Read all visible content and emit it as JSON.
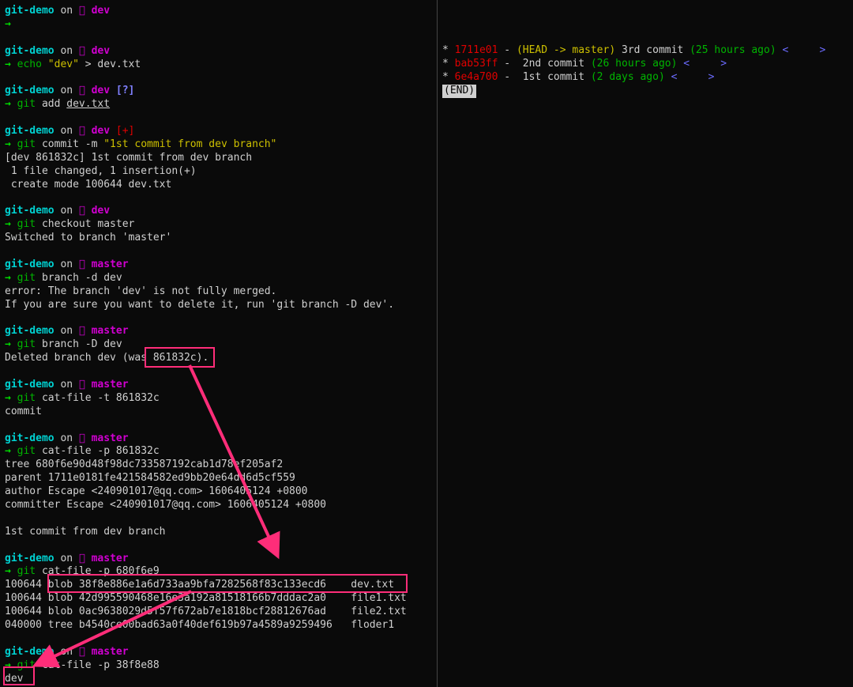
{
  "prompt": {
    "dir": "git-demo",
    "on": "on",
    "branch_dev": "dev",
    "branch_master": "master",
    "flag_untracked": "[?]",
    "flag_staged": "[+]",
    "arrow": "→"
  },
  "cmds": {
    "echo": "echo",
    "echo_arg": "\"dev\"",
    "echo_redir": " > dev.txt",
    "git": "git",
    "add": " add ",
    "add_file": "dev.txt",
    "commit": " commit -m ",
    "commit_msg": "\"1st commit from dev branch\"",
    "checkout": " checkout master",
    "branch_d": " branch -d dev",
    "branch_D": " branch -D dev",
    "catfile_t": " cat-file -t 861832c",
    "catfile_p1": " cat-file -p 861832c",
    "catfile_p2": " cat-file -p 680f6e9",
    "catfile_p3": " cat-file -p 38f8e88"
  },
  "out": {
    "commit1": "[dev 861832c] 1st commit from dev branch",
    "commit2": " 1 file changed, 1 insertion(+)",
    "commit3": " create mode 100644 dev.txt",
    "switched": "Switched to branch 'master'",
    "err1": "error: The branch 'dev' is not fully merged.",
    "err2": "If you are sure you want to delete it, run 'git branch -D dev'.",
    "deleted_a": "Deleted branch dev (was",
    "deleted_b": " 861832c).",
    "type": "commit",
    "tree": "tree 680f6e90d48f98dc733587192cab1d78ef205af2",
    "parent": "parent 1711e0181fe421584582ed9bb20e64dd6d5cf559",
    "author": "author Escape <240901017@qq.com> 1606405124 +0800",
    "committer": "committer Escape <240901017@qq.com> 1606405124 +0800",
    "msg": "1st commit from dev branch",
    "ls1a": "100644 ",
    "ls1b": "blob 38f8e886e1a6d733aa9bfa7282568f83c133ecd6    dev.txt",
    "ls2": "100644 blob 42d995590468e16e3a192a81518166b7dddac2a0    file1.txt",
    "ls3": "100644 blob 0ac9638029d5f57f672ab7e1818bcf28812676ad    file2.txt",
    "ls4": "040000 tree b4540ce00bad63a0f40def619b97a4589a9259496   floder1",
    "blob": "dev"
  },
  "log": {
    "star": "*",
    "h1": "1711e01",
    "dash": " - ",
    "refs": "(HEAD -> master)",
    "m1": " 3rd commit ",
    "t1": "(25 hours ago)",
    "h2": "bab53ff",
    "m2": " 2nd commit ",
    "t2": "(26 hours ago)",
    "h3": "6e4a700",
    "m3": " 1st commit ",
    "t3": "(2 days ago)",
    "lt": "<",
    "gt": ">",
    "end": "(END)"
  }
}
